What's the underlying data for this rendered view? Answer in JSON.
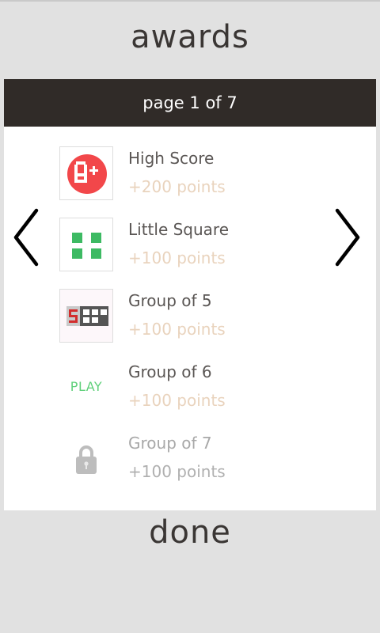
{
  "title": "awards",
  "page_label": "page 1 of 7",
  "awards": [
    {
      "name": "High Score",
      "points": "+200 points",
      "icon": "a-plus-badge-icon",
      "state": "earned"
    },
    {
      "name": "Little Square",
      "points": "+100 points",
      "icon": "green-squares-icon",
      "state": "earned"
    },
    {
      "name": "Group of 5",
      "points": "+100 points",
      "icon": "group-of-five-icon",
      "state": "earned"
    },
    {
      "name": "Group of 6",
      "points": "+100 points",
      "icon": "play-label",
      "state": "playable",
      "play_label": "PLAY"
    },
    {
      "name": "Group of 7",
      "points": "+100 points",
      "icon": "lock-icon",
      "state": "locked"
    }
  ],
  "done_label": "done",
  "colors": {
    "header_bg": "#302b28",
    "points": "#e9d3bd",
    "badge_red": "#f2474a",
    "badge_green": "#3dba63",
    "play_green": "#5fd07a",
    "lock_gray": "#bdbdbd"
  }
}
